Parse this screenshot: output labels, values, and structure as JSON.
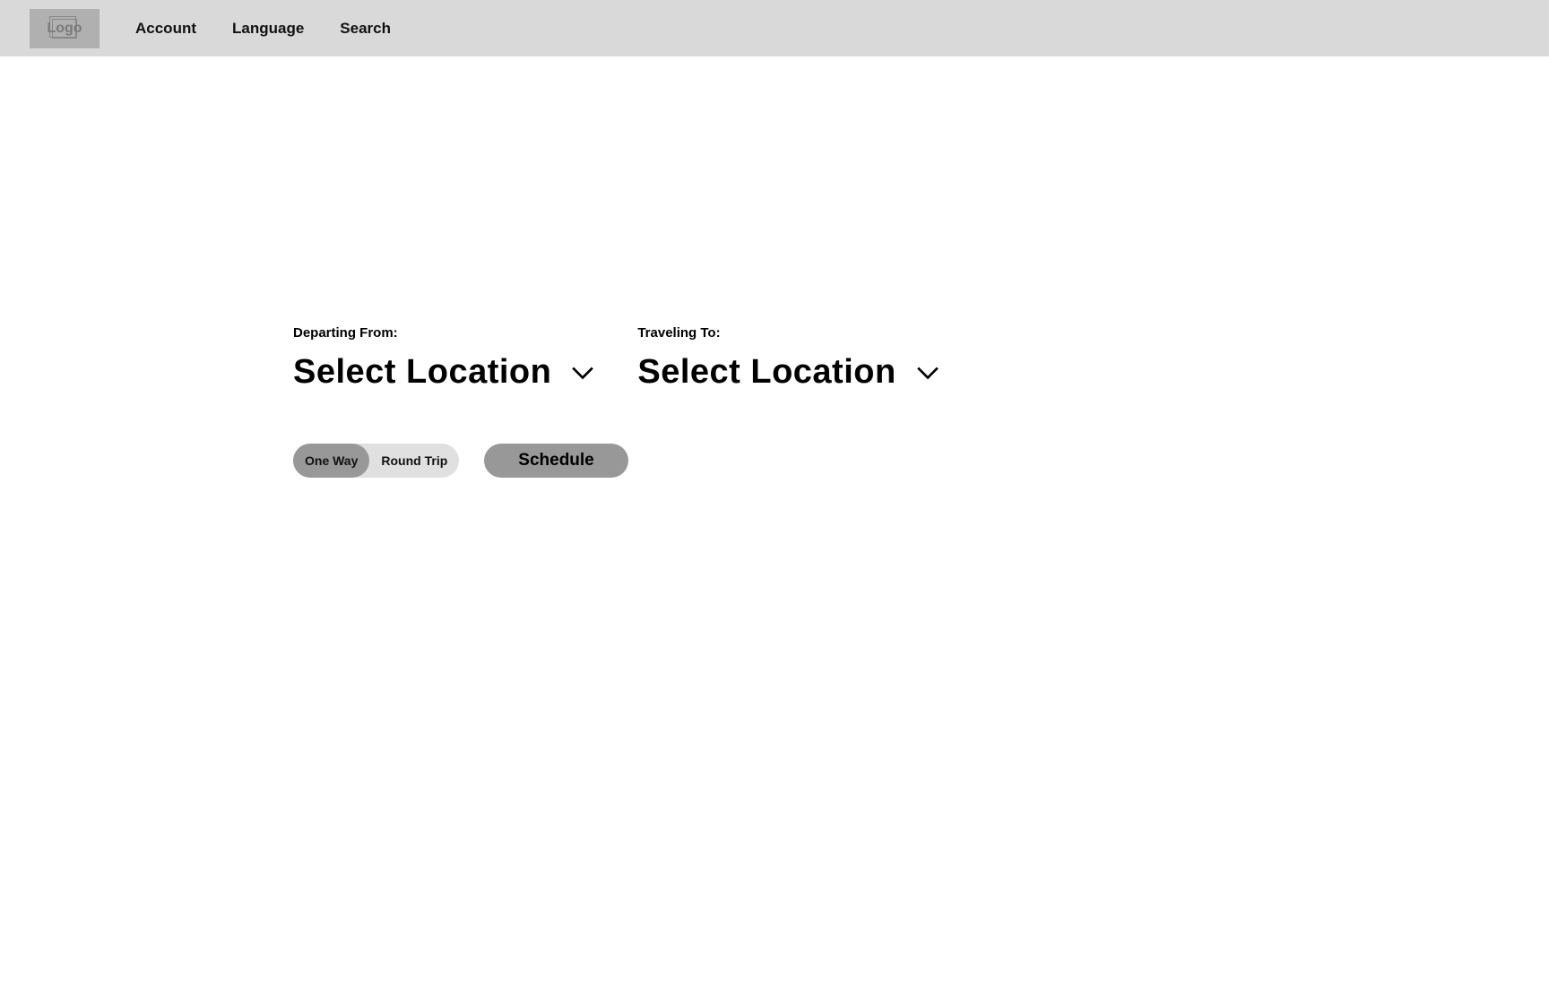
{
  "header": {
    "logo_text": "Logo",
    "nav": {
      "account": "Account",
      "language": "Language",
      "search": "Search"
    }
  },
  "form": {
    "departing": {
      "label": "Departing From:",
      "value": "Select Location"
    },
    "traveling": {
      "label": "Traveling To:",
      "value": "Select Location"
    },
    "trip_type": {
      "one_way": "One Way",
      "round_trip": "Round Trip",
      "selected": "one_way"
    },
    "schedule_button": "Schedule"
  },
  "icons": {
    "chevron_down": "chevron-down-icon",
    "logo_placeholder": "image-placeholder-icon"
  }
}
